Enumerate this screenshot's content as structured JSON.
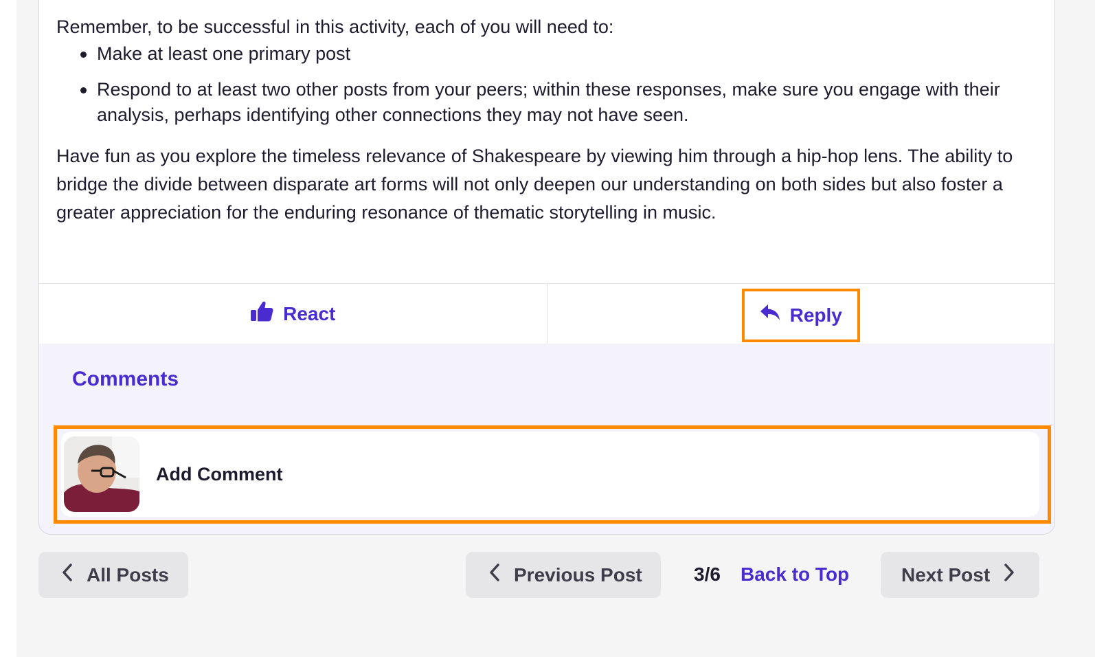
{
  "post": {
    "intro": "Remember, to be successful in this activity, each of you will need to:",
    "requirements": [
      "Make at least one primary post",
      "Respond to at least two other posts from your peers; within these responses, make sure you engage with their analysis, perhaps identifying other connections they may not have seen."
    ],
    "closing": "Have fun as you explore the timeless relevance of Shakespeare by viewing him through a hip-hop lens. The ability to bridge the divide between disparate art forms will not only deepen our understanding on both sides but also foster a greater appreciation for the enduring resonance of thematic storytelling in music."
  },
  "actions": {
    "react_label": "React",
    "reply_label": "Reply"
  },
  "comments": {
    "title": "Comments",
    "add_comment_label": "Add Comment"
  },
  "navigation": {
    "all_posts_label": "All Posts",
    "previous_post_label": "Previous Post",
    "page_position": "3/6",
    "back_to_top_label": "Back to Top",
    "next_post_label": "Next Post"
  },
  "colors": {
    "accent": "#4a2bd0",
    "highlight": "#ff8a00",
    "comments_bg": "#f4f3fb",
    "nav_button_bg": "#e6e6e9"
  },
  "icons": {
    "react": "thumbs-up-icon",
    "reply": "reply-arrow-icon",
    "prev": "chevron-left-icon",
    "next": "chevron-right-icon"
  }
}
